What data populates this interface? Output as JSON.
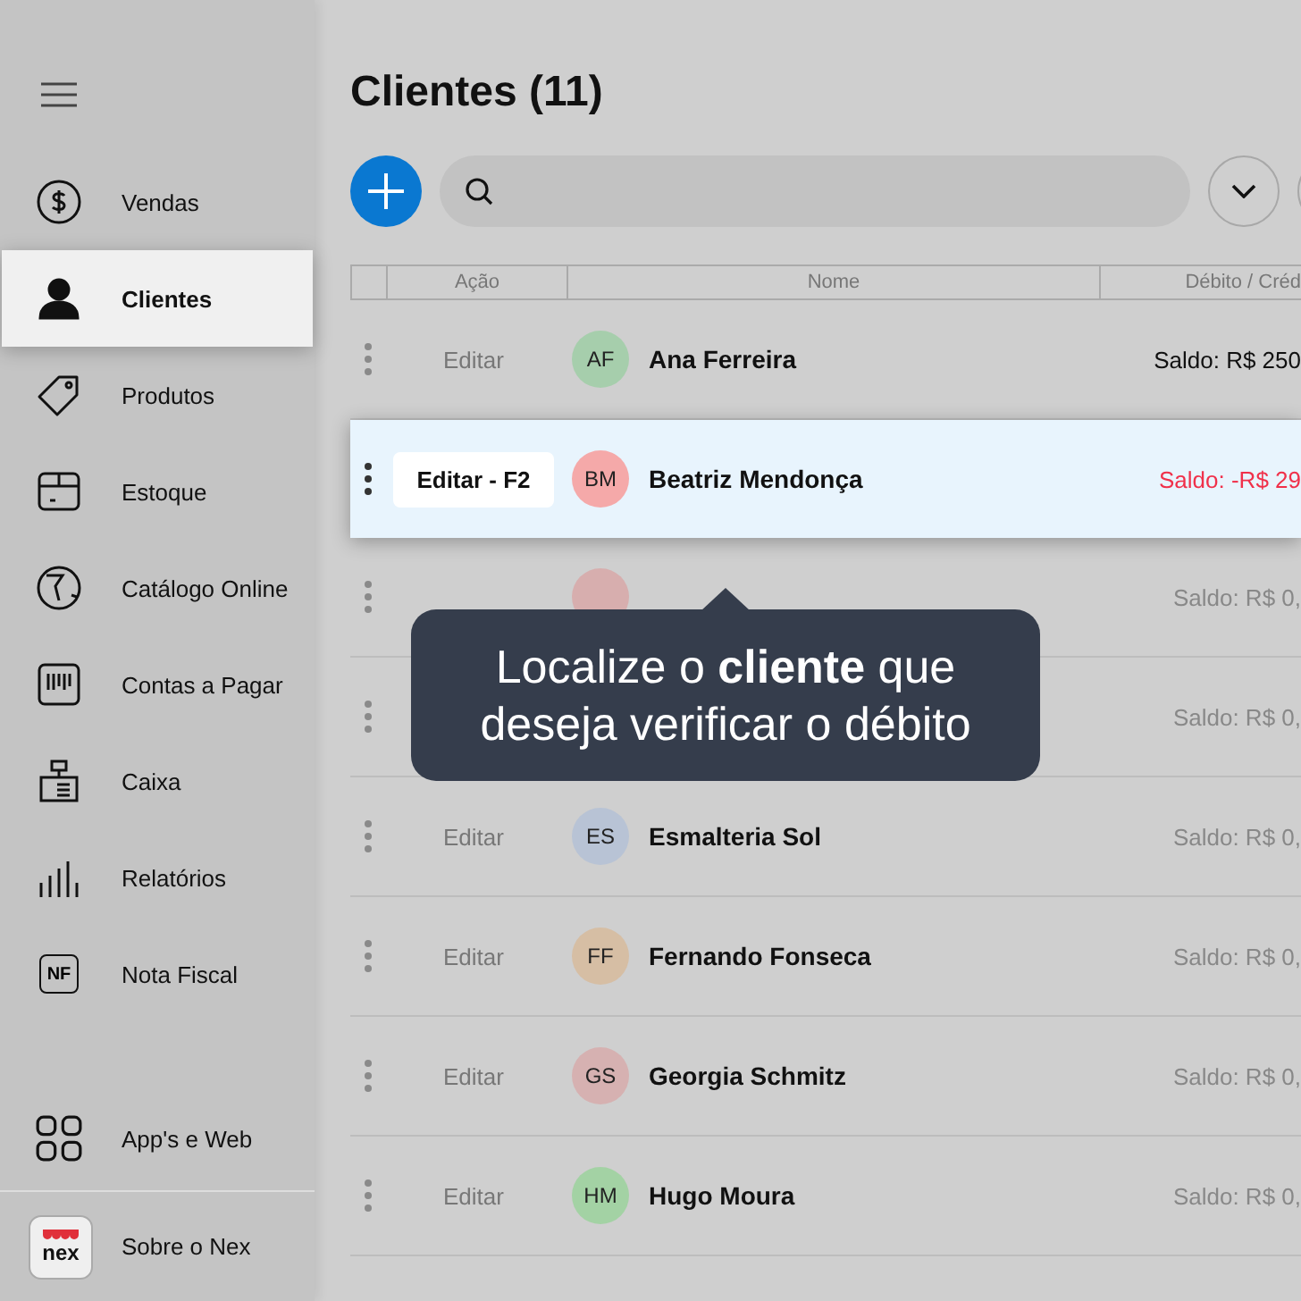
{
  "sidebar": {
    "items": [
      {
        "label": "Vendas",
        "selected": false
      },
      {
        "label": "Clientes",
        "selected": true
      },
      {
        "label": "Produtos",
        "selected": false
      },
      {
        "label": "Estoque",
        "selected": false
      },
      {
        "label": "Catálogo Online",
        "selected": false
      },
      {
        "label": "Contas a Pagar",
        "selected": false
      },
      {
        "label": "Caixa",
        "selected": false
      },
      {
        "label": "Relatórios",
        "selected": false
      },
      {
        "label": "Nota Fiscal",
        "selected": false,
        "icon_text": "NF"
      }
    ],
    "bottom": {
      "apps_label": "App's e Web",
      "about_label": "Sobre o Nex",
      "logo_text": "nex"
    }
  },
  "title": "Clientes (11)",
  "table": {
    "columns": [
      "Ação",
      "Nome",
      "Débito / Créd"
    ],
    "rows": [
      {
        "action": "Editar",
        "initials": "AF",
        "color": "#a6ceac",
        "name": "Ana Ferreira",
        "balance": "Saldo: R$ 250",
        "negative": false,
        "selected": false
      },
      {
        "action": "Editar - F2",
        "initials": "BM",
        "color": "#f5a9a9",
        "name": "Beatriz Mendonça",
        "balance": "Saldo: -R$ 29",
        "negative": true,
        "selected": true
      },
      {
        "color": "#d7aeae",
        "balance": "Saldo: R$ 0,",
        "negative": false,
        "selected": false
      },
      {
        "balance": "Saldo: R$ 0,",
        "negative": false,
        "selected": false
      },
      {
        "action": "Editar",
        "initials": "ES",
        "color": "#b8c3d5",
        "name": "Esmalteria Sol",
        "balance": "Saldo: R$ 0,",
        "negative": false,
        "selected": false
      },
      {
        "action": "Editar",
        "initials": "FF",
        "color": "#d6bea4",
        "name": "Fernando Fonseca",
        "balance": "Saldo: R$ 0,",
        "negative": false,
        "selected": false
      },
      {
        "action": "Editar",
        "initials": "GS",
        "color": "#d6b1b1",
        "name": "Georgia Schmitz",
        "balance": "Saldo: R$ 0,",
        "negative": false,
        "selected": false
      },
      {
        "action": "Editar",
        "initials": "HM",
        "color": "#a3d2a4",
        "name": "Hugo Moura",
        "balance": "Saldo: R$ 0,",
        "negative": false,
        "selected": false
      }
    ]
  },
  "tooltip": "Localize o **cliente** que deseja verificar o débito"
}
